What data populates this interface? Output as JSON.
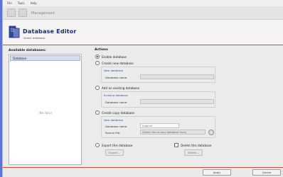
{
  "menu": [
    "File",
    "Tools",
    "Help"
  ],
  "toolbar": {
    "title": "Management"
  },
  "header": {
    "title": "Database Editor",
    "subtitle": "Select database"
  },
  "left": {
    "label": "Available databases:",
    "items": [
      "Database"
    ],
    "empty_text": "(No data)"
  },
  "right": {
    "label": "Actions",
    "options": {
      "enable": "Enable database",
      "create": "Create new database",
      "existing": "Add an existing database",
      "copy": "Create copy database",
      "export": "Export this database",
      "delete": "Delete this database"
    },
    "create_box": {
      "title": "New database",
      "label": "Database name:"
    },
    "existing_box": {
      "title": "Existing database",
      "label": "Database name:"
    },
    "copy_box": {
      "title": "New database",
      "name_label": "Database name:",
      "name_value": "Copy of",
      "path_label": "Source file:",
      "path_value": "(Select file to copy database from)"
    },
    "export_button": "Export...",
    "delete_button": "Delete..."
  },
  "footer": {
    "ok_label": "Apply",
    "cancel_label": "Cancel"
  }
}
